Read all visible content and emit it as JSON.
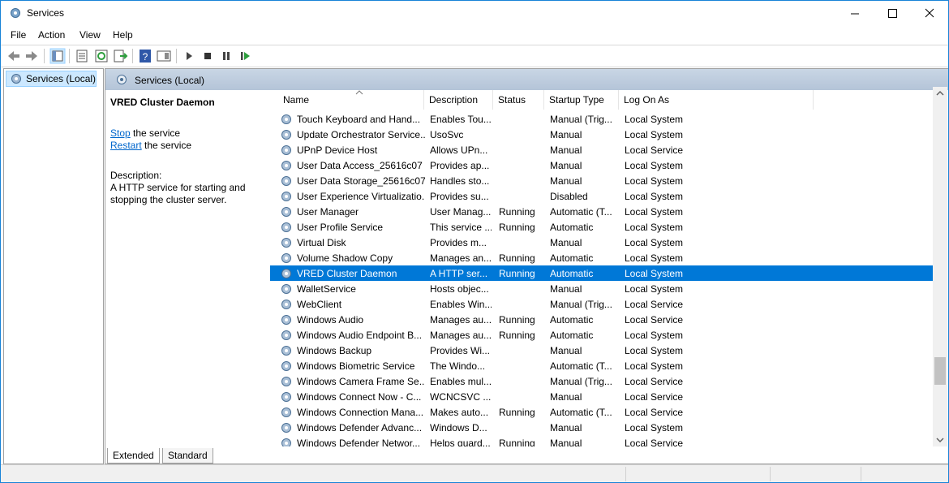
{
  "window": {
    "title": "Services"
  },
  "menu": [
    "File",
    "Action",
    "View",
    "Help"
  ],
  "tree": {
    "item": "Services (Local)"
  },
  "main": {
    "header": "Services (Local)"
  },
  "info": {
    "title": "VRED Cluster Daemon",
    "stop_link": "Stop",
    "stop_rest": " the service",
    "restart_link": "Restart",
    "restart_rest": " the service",
    "description_label": "Description:",
    "description_text": "A HTTP service for starting and stopping the cluster server."
  },
  "columns": {
    "name": "Name",
    "description": "Description",
    "status": "Status",
    "startup": "Startup Type",
    "logon": "Log On As"
  },
  "services": [
    {
      "name": "Touch Keyboard and Hand...",
      "description": "Enables Tou...",
      "status": "",
      "startup": "Manual (Trig...",
      "logon": "Local System"
    },
    {
      "name": "Update Orchestrator Service...",
      "description": "UsoSvc",
      "status": "",
      "startup": "Manual",
      "logon": "Local System"
    },
    {
      "name": "UPnP Device Host",
      "description": "Allows UPn...",
      "status": "",
      "startup": "Manual",
      "logon": "Local Service"
    },
    {
      "name": "User Data Access_25616c07",
      "description": "Provides ap...",
      "status": "",
      "startup": "Manual",
      "logon": "Local System"
    },
    {
      "name": "User Data Storage_25616c07",
      "description": "Handles sto...",
      "status": "",
      "startup": "Manual",
      "logon": "Local System"
    },
    {
      "name": "User Experience Virtualizatio...",
      "description": "Provides su...",
      "status": "",
      "startup": "Disabled",
      "logon": "Local System"
    },
    {
      "name": "User Manager",
      "description": "User Manag...",
      "status": "Running",
      "startup": "Automatic (T...",
      "logon": "Local System"
    },
    {
      "name": "User Profile Service",
      "description": "This service ...",
      "status": "Running",
      "startup": "Automatic",
      "logon": "Local System"
    },
    {
      "name": "Virtual Disk",
      "description": "Provides m...",
      "status": "",
      "startup": "Manual",
      "logon": "Local System"
    },
    {
      "name": "Volume Shadow Copy",
      "description": "Manages an...",
      "status": "Running",
      "startup": "Automatic",
      "logon": "Local System"
    },
    {
      "name": "VRED Cluster Daemon",
      "description": "A HTTP ser...",
      "status": "Running",
      "startup": "Automatic",
      "logon": "Local System",
      "selected": true
    },
    {
      "name": "WalletService",
      "description": "Hosts objec...",
      "status": "",
      "startup": "Manual",
      "logon": "Local System"
    },
    {
      "name": "WebClient",
      "description": "Enables Win...",
      "status": "",
      "startup": "Manual (Trig...",
      "logon": "Local Service"
    },
    {
      "name": "Windows Audio",
      "description": "Manages au...",
      "status": "Running",
      "startup": "Automatic",
      "logon": "Local Service"
    },
    {
      "name": "Windows Audio Endpoint B...",
      "description": "Manages au...",
      "status": "Running",
      "startup": "Automatic",
      "logon": "Local System"
    },
    {
      "name": "Windows Backup",
      "description": "Provides Wi...",
      "status": "",
      "startup": "Manual",
      "logon": "Local System"
    },
    {
      "name": "Windows Biometric Service",
      "description": "The Windo...",
      "status": "",
      "startup": "Automatic (T...",
      "logon": "Local System"
    },
    {
      "name": "Windows Camera Frame Se...",
      "description": "Enables mul...",
      "status": "",
      "startup": "Manual (Trig...",
      "logon": "Local Service"
    },
    {
      "name": "Windows Connect Now - C...",
      "description": "WCNCSVC ...",
      "status": "",
      "startup": "Manual",
      "logon": "Local Service"
    },
    {
      "name": "Windows Connection Mana...",
      "description": "Makes auto...",
      "status": "Running",
      "startup": "Automatic (T...",
      "logon": "Local Service"
    },
    {
      "name": "Windows Defender Advanc...",
      "description": "Windows D...",
      "status": "",
      "startup": "Manual",
      "logon": "Local System"
    },
    {
      "name": "Windows Defender Networ...",
      "description": "Helps guard...",
      "status": "Running",
      "startup": "Manual",
      "logon": "Local Service"
    }
  ],
  "tabs": [
    "Extended",
    "Standard"
  ],
  "colors": {
    "selection": "#0078d7",
    "header": "#c9d6e5",
    "link": "#0066cc"
  }
}
